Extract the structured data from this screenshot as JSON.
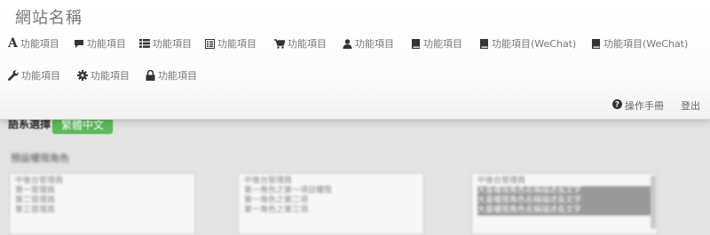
{
  "brand": "網站名稱",
  "nav_row1": [
    {
      "label": "功能項目",
      "icon": "font-icon"
    },
    {
      "label": "功能項目",
      "icon": "comment-icon"
    },
    {
      "label": "功能項目",
      "icon": "list-icon"
    },
    {
      "label": "功能項目",
      "icon": "list-alt-icon"
    },
    {
      "label": "功能項目",
      "icon": "cart-icon"
    },
    {
      "label": "功能項目",
      "icon": "user-icon"
    },
    {
      "label": "功能項目",
      "icon": "book-icon"
    },
    {
      "label": "功能項目(WeChat)",
      "icon": "book-icon"
    },
    {
      "label": "功能項目(WeChat)",
      "icon": "book-icon"
    }
  ],
  "nav_row2": [
    {
      "label": "功能項目",
      "icon": "wrench-icon"
    },
    {
      "label": "功能項目",
      "icon": "cog-icon"
    },
    {
      "label": "功能項目",
      "icon": "lock-icon"
    }
  ],
  "right_links": {
    "manual": "操作手冊",
    "manual_icon": "question-circle-icon",
    "logout": "登出"
  },
  "background": {
    "lang_label": "語系選擇",
    "lang_button": "繁體中文",
    "section_title": "預設權限角色",
    "lists": [
      {
        "lines": [
          "中後台管理員",
          "第一管理員",
          "第二管理員",
          "第三管理員"
        ]
      },
      {
        "lines": [
          "中後台管理員",
          "第一角色之第一項目權限",
          "第一角色之第二項",
          "第一角色之第三項"
        ]
      },
      {
        "lines": [
          "中後台管理員",
          "大量權限角色名稱描述長文字",
          "大量權限角色名稱描述長文字",
          "大量權限角色名稱描述長文字"
        ]
      }
    ]
  },
  "colors": {
    "nav_bg": "#f8f8f8",
    "success": "#5cb85c",
    "page_bg": "#e3e3e3"
  }
}
